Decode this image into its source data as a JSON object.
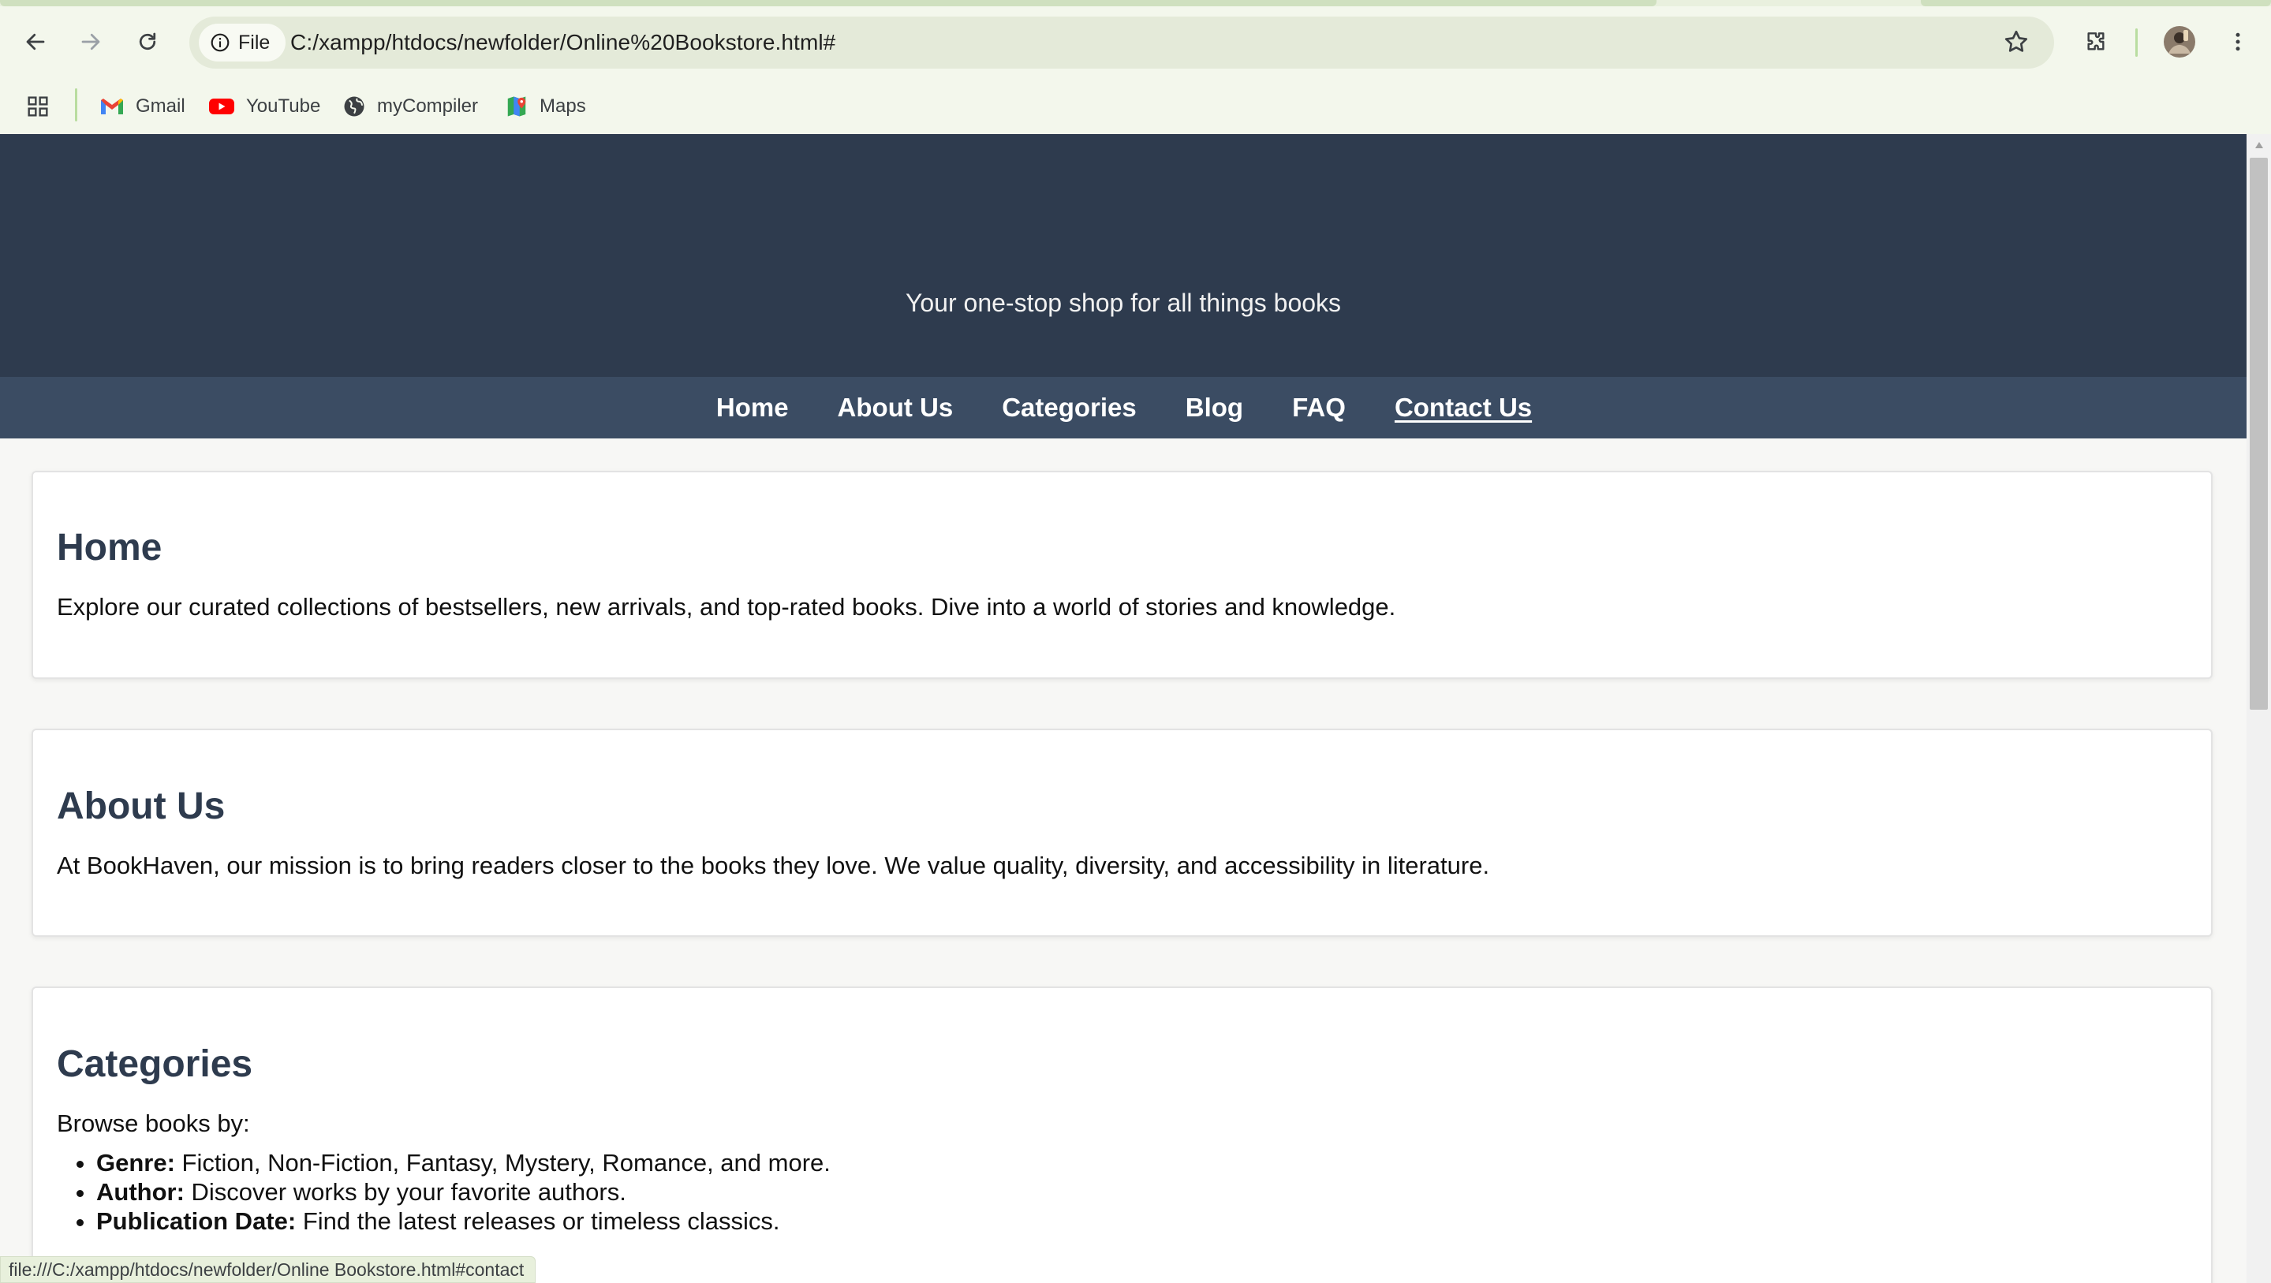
{
  "browser": {
    "back_icon": "arrow-left-icon",
    "forward_icon": "arrow-right-icon",
    "reload_icon": "reload-icon",
    "site_info_label": "File",
    "url": "C:/xampp/htdocs/newfolder/Online%20Bookstore.html#",
    "bookmarks": [
      {
        "label": "Gmail",
        "icon": "gmail-icon"
      },
      {
        "label": "YouTube",
        "icon": "youtube-icon"
      },
      {
        "label": "myCompiler",
        "icon": "globe-icon"
      },
      {
        "label": "Maps",
        "icon": "maps-icon"
      }
    ],
    "status_url": "file:///C:/xampp/htdocs/newfolder/Online Bookstore.html#contact"
  },
  "header": {
    "tagline": "Your one-stop shop for all things books"
  },
  "nav": {
    "items": [
      {
        "label": "Home"
      },
      {
        "label": "About Us"
      },
      {
        "label": "Categories"
      },
      {
        "label": "Blog"
      },
      {
        "label": "FAQ"
      },
      {
        "label": "Contact Us",
        "state": "hover"
      }
    ]
  },
  "sections": {
    "home": {
      "title": "Home",
      "text": "Explore our curated collections of bestsellers, new arrivals, and top-rated books. Dive into a world of stories and knowledge."
    },
    "about": {
      "title": "About Us",
      "text": "At BookHaven, our mission is to bring readers closer to the books they love. We value quality, diversity, and accessibility in literature."
    },
    "categories": {
      "title": "Categories",
      "intro": "Browse books by:",
      "items": [
        {
          "term": "Genre:",
          "desc": " Fiction, Non-Fiction, Fantasy, Mystery, Romance, and more."
        },
        {
          "term": "Author:",
          "desc": " Discover works by your favorite authors."
        },
        {
          "term": "Publication Date:",
          "desc": " Find the latest releases or timeless classics."
        }
      ]
    }
  },
  "colors": {
    "header_bg": "#2e3b4e",
    "nav_bg": "#3b4c63",
    "heading": "#2e3b4e",
    "chrome_bg": "#f3f7ec"
  }
}
